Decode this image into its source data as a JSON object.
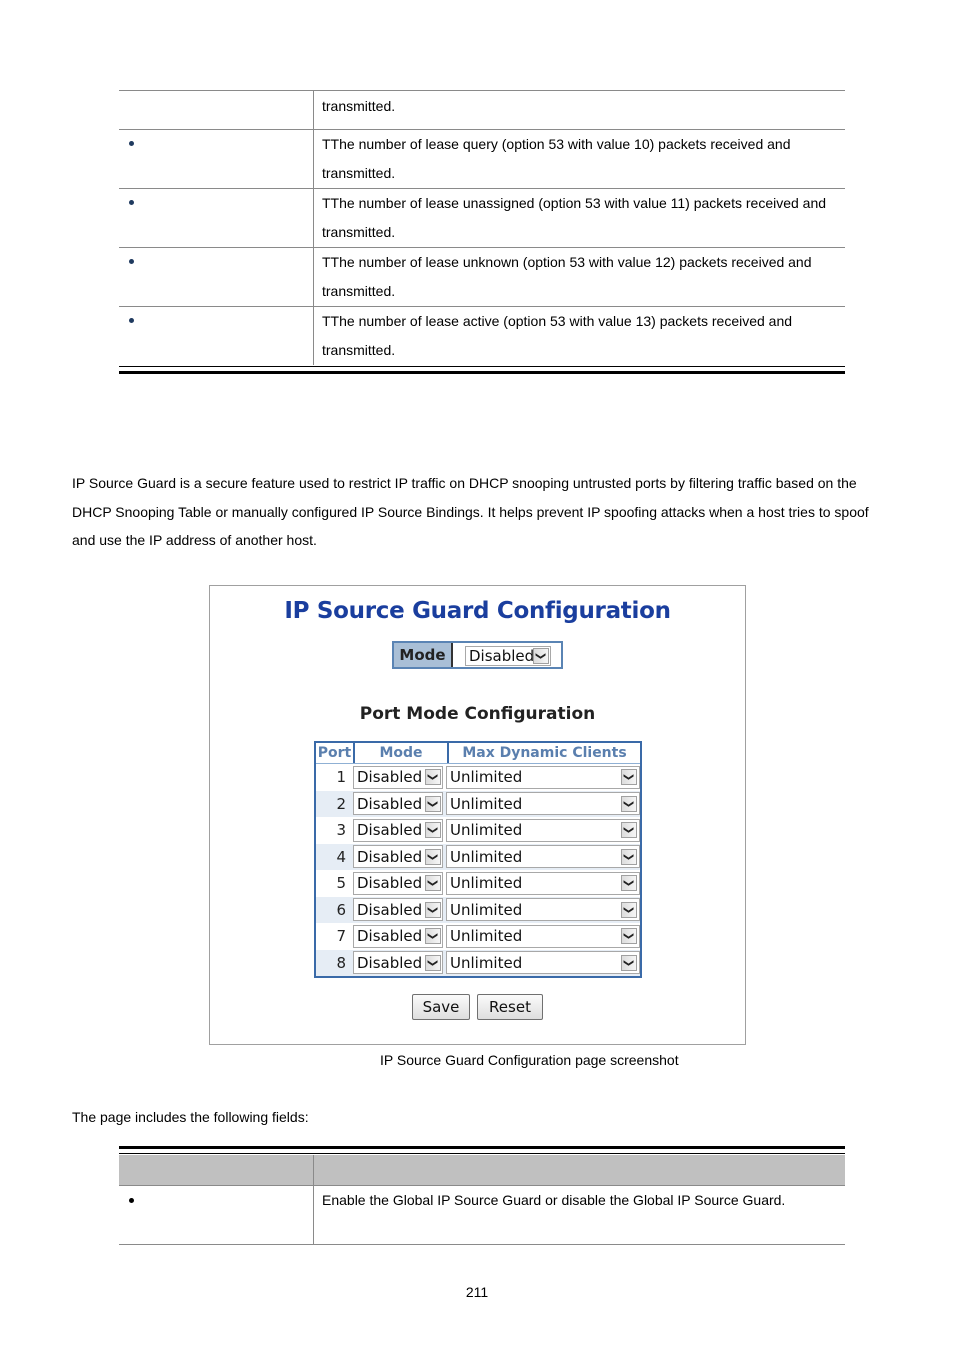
{
  "top_table": {
    "rows": [
      {
        "bullet": false,
        "description": "transmitted."
      },
      {
        "bullet": true,
        "description": "TThe number of lease query (option 53 with value 10) packets received and transmitted."
      },
      {
        "bullet": true,
        "description": "TThe number of lease unassigned (option 53 with value 11) packets received and transmitted."
      },
      {
        "bullet": true,
        "description": "TThe number of lease unknown (option 53 with value 12) packets received and transmitted."
      },
      {
        "bullet": true,
        "description": "TThe number of lease active (option 53 with value 13) packets received and transmitted."
      }
    ]
  },
  "intro_paragraph": "IP Source Guard is a secure feature used to restrict IP traffic on DHCP snooping untrusted ports by filtering traffic based on the DHCP Snooping Table or manually configured IP Source Bindings. It helps prevent IP spoofing attacks when a host tries to spoof and use the IP address of another host.",
  "screenshot": {
    "title": "IP Source Guard Configuration",
    "mode_label": "Mode",
    "mode_value": "Disabled",
    "port_section_title": "Port Mode Configuration",
    "columns": [
      "Port",
      "Mode",
      "Max Dynamic Clients"
    ],
    "ports": [
      {
        "port": "1",
        "mode": "Disabled",
        "max_dynamic_clients": "Unlimited"
      },
      {
        "port": "2",
        "mode": "Disabled",
        "max_dynamic_clients": "Unlimited"
      },
      {
        "port": "3",
        "mode": "Disabled",
        "max_dynamic_clients": "Unlimited"
      },
      {
        "port": "4",
        "mode": "Disabled",
        "max_dynamic_clients": "Unlimited"
      },
      {
        "port": "5",
        "mode": "Disabled",
        "max_dynamic_clients": "Unlimited"
      },
      {
        "port": "6",
        "mode": "Disabled",
        "max_dynamic_clients": "Unlimited"
      },
      {
        "port": "7",
        "mode": "Disabled",
        "max_dynamic_clients": "Unlimited"
      },
      {
        "port": "8",
        "mode": "Disabled",
        "max_dynamic_clients": "Unlimited"
      }
    ],
    "save_label": "Save",
    "reset_label": "Reset",
    "colors": {
      "title": "#1a3e9e",
      "table_border": "#3a6aa8",
      "header_text": "#5a7fae",
      "mode_label_bg": "#a9bfd6"
    }
  },
  "caption": "IP Source Guard Configuration page screenshot",
  "fields_intro": "The page includes the following fields:",
  "fields_table": {
    "header": [
      "",
      ""
    ],
    "rows": [
      {
        "bullet": true,
        "description": "Enable the Global IP Source Guard or disable the Global IP Source Guard."
      }
    ]
  },
  "page_number": "211"
}
